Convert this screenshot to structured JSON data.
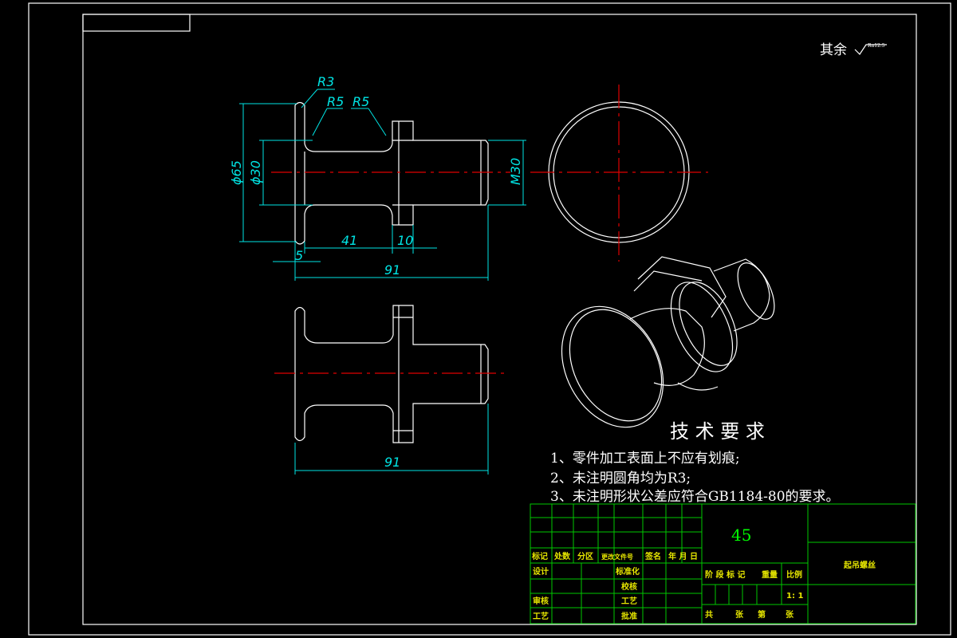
{
  "surface_note": "其余",
  "surface_symbol_value": "Ra12.5",
  "dimensions": {
    "r3": "R3",
    "r5_left": "R5",
    "r5_right": "R5",
    "phi65": "ϕ65",
    "phi30": "ϕ30",
    "m30": "M30",
    "d41": "41",
    "d10": "10",
    "d5": "5",
    "d91_top": "91",
    "d91_bottom": "91"
  },
  "tech_req": {
    "title": "技 术 要 求",
    "items": [
      "1、零件加工表面上不应有划痕;",
      "2、未注明圆角均为R3;",
      "3、未注明形状公差应符合GB1184-80的要求。"
    ]
  },
  "title_block": {
    "material": "45",
    "part_name": "起吊螺丝",
    "scale": "1: 1",
    "header_row": [
      "标记",
      "处数",
      "分区",
      "更改文件号",
      "签名",
      "年 月 日"
    ],
    "design": "设计",
    "standardization": "标准化",
    "check": "审核",
    "craft": "工艺",
    "proofread": "校核",
    "approve": "批准",
    "stage_mark": "阶 段 标 记",
    "weight": "重量",
    "ratio": "比例",
    "total": "共",
    "sheet": "张",
    "page_no": "第",
    "sheet2": "张"
  }
}
